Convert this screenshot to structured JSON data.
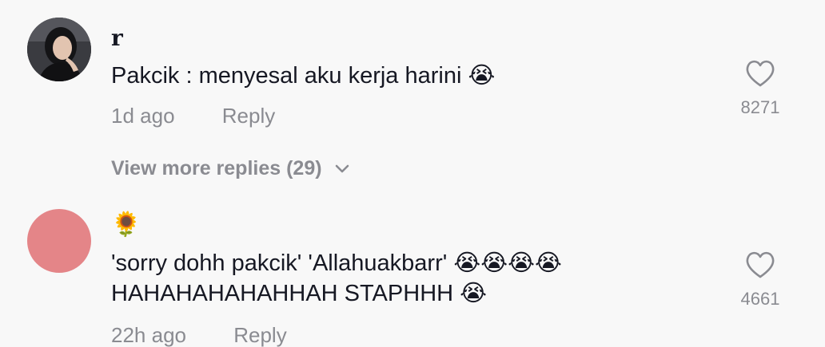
{
  "comments": [
    {
      "username": "r",
      "text": "Pakcik : menyesal aku kerja harini 😭",
      "time": "1d ago",
      "reply_label": "Reply",
      "like_count": "8271",
      "view_more": "View more replies (29)"
    },
    {
      "username": "🌻",
      "text_lines": [
        "'sorry dohh pakcik' 'Allahuakbarr' 😭😭😭😭",
        "HAHAHAHAHAHHAH STAPHHH 😭"
      ],
      "time": "22h ago",
      "reply_label": "Reply",
      "like_count": "4661"
    }
  ],
  "colors": {
    "background": "#f8f8f8",
    "primary_text": "#161823",
    "secondary_text": "#8a8b91",
    "avatar_2": "#e48588"
  }
}
